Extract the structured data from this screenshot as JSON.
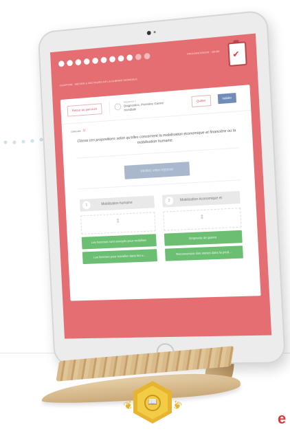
{
  "progress": {
    "total_steps": 11,
    "completed_steps": 9,
    "label": "PROGRESSION : 80/80"
  },
  "breadcrumb": "CHAPITRE · MÉTIER & SECTEURS DE LA GUERRE MONDIALE",
  "course": {
    "back_label": "Retour au parcours",
    "subtitle": "Séquence 1",
    "title": "Diagnostics, Première Guerre mondiale"
  },
  "actions": {
    "secondary_label": "Quitter",
    "primary_label": "Valider"
  },
  "tags_label": "Difficulté",
  "tags_marks": "///",
  "instruction": "Classe ces propositions selon qu'elles concernent la mobilisation économique et financière ou la mobilisation humaine.",
  "check_button_label": "Vérifiez votre réponse",
  "columns": [
    {
      "number": "1",
      "header": "Mobilisation humaine",
      "items": [
        "Les hommes sont envoyés pour mobiliser",
        "Les femmes pour travailler dans les u..."
      ]
    },
    {
      "number": "2",
      "header": "Mobilisation économique et",
      "items": [
        "Emprunts de guerre",
        "Reconversion des usines dans la prod..."
      ]
    }
  ],
  "footer_letter": "e",
  "colors": {
    "screen_bg": "#e46e72",
    "primary": "#6f8db6",
    "chip_green": "#6cbf72",
    "badge_gold": "#e6b431"
  }
}
